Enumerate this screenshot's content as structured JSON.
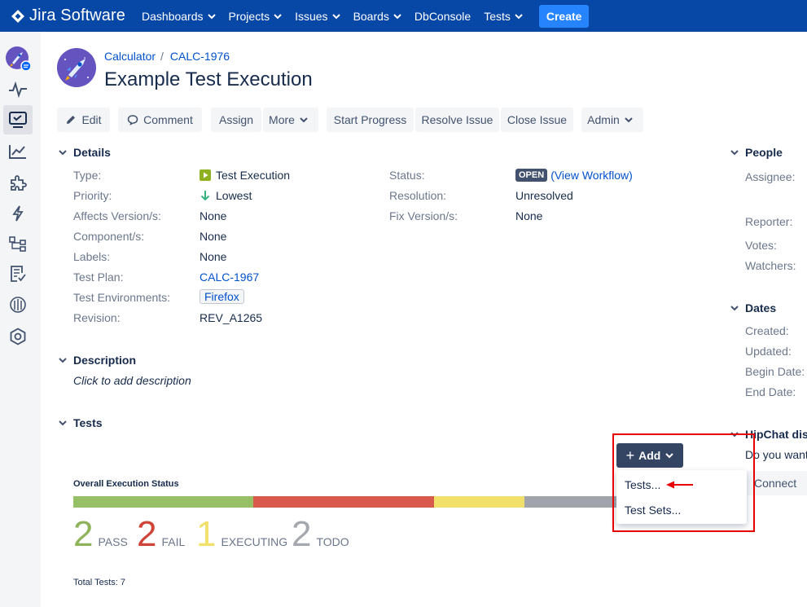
{
  "nav": {
    "logo_text": "Jira Software",
    "items": [
      "Dashboards",
      "Projects",
      "Issues",
      "Boards",
      "DbConsole",
      "Tests"
    ],
    "items_with_chevron": [
      true,
      true,
      true,
      true,
      false,
      true
    ],
    "create_label": "Create"
  },
  "breadcrumb": {
    "project": "Calculator",
    "issue_key": "CALC-1976"
  },
  "title": "Example Test Execution",
  "toolbar": {
    "edit": "Edit",
    "comment": "Comment",
    "assign": "Assign",
    "more": "More",
    "start_progress": "Start Progress",
    "resolve_issue": "Resolve Issue",
    "close_issue": "Close Issue",
    "admin": "Admin"
  },
  "details": {
    "heading": "Details",
    "type_label": "Type:",
    "type_value": "Test Execution",
    "priority_label": "Priority:",
    "priority_value": "Lowest",
    "affects_label": "Affects Version/s:",
    "affects_value": "None",
    "component_label": "Component/s:",
    "component_value": "None",
    "labels_label": "Labels:",
    "labels_value": "None",
    "testplan_label": "Test Plan:",
    "testplan_value": "CALC-1967",
    "testenv_label": "Test Environments:",
    "testenv_value": "Firefox",
    "revision_label": "Revision:",
    "revision_value": "REV_A1265",
    "status_label": "Status:",
    "status_value": "OPEN",
    "status_link": "(View Workflow)",
    "resolution_label": "Resolution:",
    "resolution_value": "Unresolved",
    "fixversion_label": "Fix Version/s:",
    "fixversion_value": "None"
  },
  "description": {
    "heading": "Description",
    "placeholder": "Click to add description"
  },
  "tests": {
    "heading": "Tests",
    "add_label": "Add",
    "menu": [
      "Tests...",
      "Test Sets..."
    ],
    "exec_title": "Overall Execution Status",
    "stats": [
      {
        "count": "2",
        "label": "PASS",
        "color": "#8eb35a"
      },
      {
        "count": "2",
        "label": "FAIL",
        "color": "#d04437"
      },
      {
        "count": "1",
        "label": "EXECUTING",
        "color": "#f1e06a"
      },
      {
        "count": "2",
        "label": "TODO",
        "color": "#a5a8ae"
      }
    ],
    "bar_colors": {
      "pass": "#97bf66",
      "fail": "#d9594c",
      "executing": "#f1e06a",
      "todo": "#a1a4ab"
    },
    "total": "Total Tests: 7"
  },
  "people": {
    "heading": "People",
    "assignee_label": "Assignee:",
    "reporter_label": "Reporter:",
    "votes_label": "Votes:",
    "watchers_label": "Watchers:"
  },
  "dates": {
    "heading": "Dates",
    "created_label": "Created:",
    "updated_label": "Updated:",
    "begin_label": "Begin Date:",
    "end_label": "End Date:"
  },
  "hipchat": {
    "heading": "HipChat disc",
    "text": "Do you want",
    "connect": "Connect"
  },
  "colors": {
    "nav_bg": "#0747a6",
    "create_bg": "#2684ff",
    "link": "#0052cc",
    "highlight": "#e60000"
  }
}
